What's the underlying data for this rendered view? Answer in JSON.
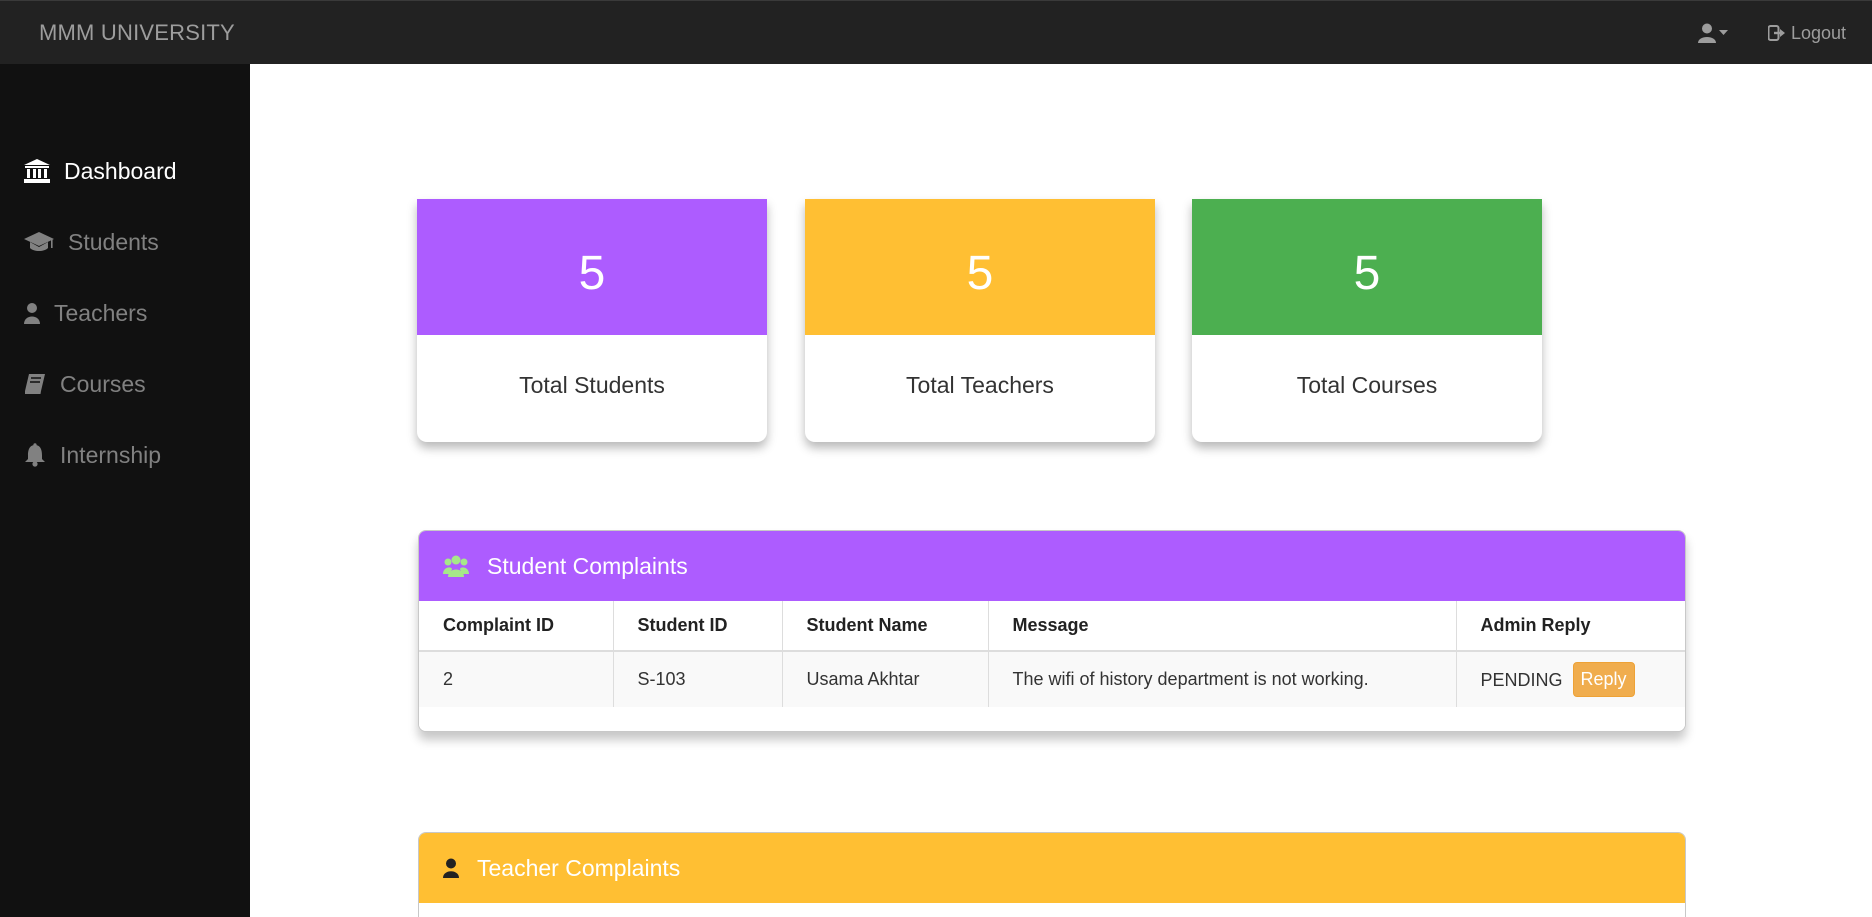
{
  "app": {
    "brand": "MMM UNIVERSITY"
  },
  "navbar": {
    "user_icon": "user-icon",
    "logout_label": "Logout"
  },
  "sidebar": {
    "items": [
      {
        "label": "Dashboard",
        "icon": "bank-icon",
        "active": true
      },
      {
        "label": "Students",
        "icon": "graduation-cap-icon",
        "active": false
      },
      {
        "label": "Teachers",
        "icon": "user-icon",
        "active": false
      },
      {
        "label": "Courses",
        "icon": "book-icon",
        "active": false
      },
      {
        "label": "Internship",
        "icon": "bell-icon",
        "active": false
      }
    ]
  },
  "stats": [
    {
      "value": "5",
      "label": "Total Students",
      "color": "#ad5cff"
    },
    {
      "value": "5",
      "label": "Total Teachers",
      "color": "#ffbf33"
    },
    {
      "value": "5",
      "label": "Total Courses",
      "color": "#4caf50"
    }
  ],
  "student_complaints": {
    "title": "Student Complaints",
    "color": "#ad5cff",
    "icon_color": "#a6e88a",
    "columns": [
      "Complaint ID",
      "Student ID",
      "Student Name",
      "Message",
      "Admin Reply"
    ],
    "rows": [
      {
        "complaint_id": "2",
        "student_id": "S-103",
        "student_name": "Usama Akhtar",
        "message": "The wifi of history department is not working.",
        "status": "PENDING",
        "action": "Reply"
      }
    ]
  },
  "teacher_complaints": {
    "title": "Teacher Complaints",
    "color": "#ffbf33"
  }
}
